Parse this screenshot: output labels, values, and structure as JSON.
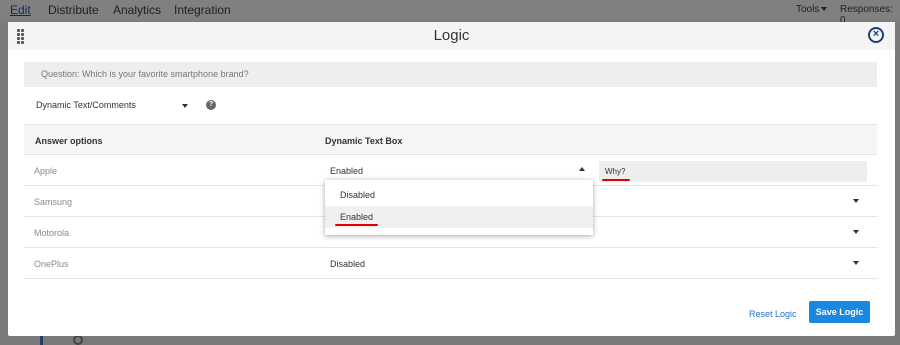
{
  "nav": {
    "tabs": [
      "Edit",
      "Distribute",
      "Analytics",
      "Integration"
    ],
    "tools_label": "Tools",
    "responses_label": "Responses: 0"
  },
  "modal": {
    "title": "Logic",
    "question": "Question: Which is your favorite smartphone brand?",
    "logic_type": "Dynamic Text/Comments",
    "columns": [
      "Answer options",
      "Dynamic Text Box"
    ],
    "rows": [
      {
        "answer": "Apple",
        "value": "Enabled",
        "text_box": "Why?"
      },
      {
        "answer": "Samsung",
        "value": ""
      },
      {
        "answer": "Motorola",
        "value": ""
      },
      {
        "answer": "OnePlus",
        "value": "Disabled"
      }
    ],
    "dropdown_options": [
      "Disabled",
      "Enabled"
    ],
    "dropdown_selected": "Enabled",
    "reset_label": "Reset Logic",
    "save_label": "Save Logic"
  },
  "colors": {
    "primary": "#1a87e0",
    "close_icon": "#1c3f79",
    "annotation_red": "#e10000"
  }
}
